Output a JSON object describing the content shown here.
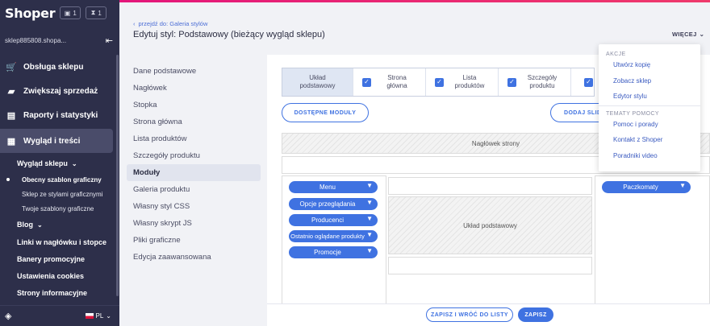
{
  "sidebar": {
    "logo": "Shoper",
    "badges": [
      {
        "icon": "box-icon",
        "count": "1"
      },
      {
        "icon": "hourglass-icon",
        "count": "1"
      }
    ],
    "shop_name": "sklep885808.shopa...",
    "nav": [
      {
        "label": "Obsługa sklepu",
        "icon": "cart-icon"
      },
      {
        "label": "Zwiększaj sprzedaż",
        "icon": "trend-icon"
      },
      {
        "label": "Raporty i statystyki",
        "icon": "report-icon"
      },
      {
        "label": "Wygląd i treści",
        "icon": "layout-icon"
      }
    ],
    "sub_head": "Wygląd sklepu",
    "sub_items": [
      "Obecny szablon graficzny",
      "Sklep ze stylami graficznymi",
      "Twoje szablony graficzne"
    ],
    "blog": "Blog",
    "links": [
      "Linki w nagłówku i stopce",
      "Banery promocyjne",
      "Ustawienia cookies",
      "Strony informacyjne"
    ],
    "lang": "PL"
  },
  "header": {
    "back_link": "przejdź do: Galeria stylów",
    "title": "Edytuj styl: Podstawowy (bieżący wygląd sklepu)",
    "more": "WIĘCEJ"
  },
  "left_menu": [
    "Dane podstawowe",
    "Nagłówek",
    "Stopka",
    "Strona główna",
    "Lista produktów",
    "Szczegóły produktu",
    "Moduły",
    "Galeria produktu",
    "Własny styl CSS",
    "Własny skrypt JS",
    "Pliki graficzne",
    "Edycja zaawansowana"
  ],
  "tabs": [
    "Układ podstawowy",
    "Strona główna",
    "Lista produktów",
    "Szczegóły produktu"
  ],
  "buttons": {
    "modules": "DOSTĘPNE MODUŁY",
    "add": "DODAJ SLID",
    "save_back": "ZAPISZ I WRÓĆ DO LISTY",
    "save": "ZAPISZ"
  },
  "layout": {
    "header_block": "Nagłówek strony",
    "center_label": "Układ podstawowy",
    "left_modules": [
      "Menu",
      "Opcje przeglądania",
      "Producenci",
      "Ostatnio oglądane produkty",
      "Promocje"
    ],
    "right_modules": [
      "Paczkomaty"
    ]
  },
  "dropdown": {
    "section1": "AKCJE",
    "actions": [
      "Utwórz kopię",
      "Zobacz sklep",
      "Edytor stylu"
    ],
    "section2": "TEMATY POMOCY",
    "help": [
      "Pomoc i porady",
      "Kontakt z Shoper",
      "Poradniki video"
    ]
  }
}
